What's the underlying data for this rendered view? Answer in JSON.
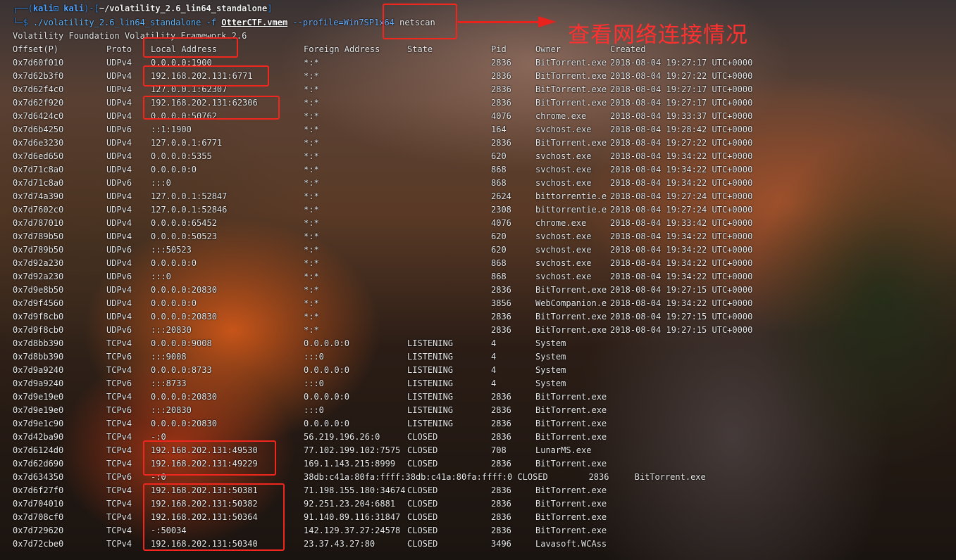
{
  "prompt": {
    "user": "kali⊡ kali",
    "path": "~/volatility_2.6_lin64_standalone",
    "command": "./volatility_2.6_lin64_standalone",
    "file": "OtterCTF.vmem",
    "option": "--profile=Win7SP1x64",
    "plugin": "netscan"
  },
  "banner": "Volatility Foundation Volatility Framework 2.6",
  "columns": [
    "Offset(P)",
    "Proto",
    "Local Address",
    "Foreign Address",
    "State",
    "Pid",
    "Owner",
    "Created"
  ],
  "rows": [
    [
      "0x7d60f010",
      "UDPv4",
      "0.0.0.0:1900",
      "*:*",
      "",
      "2836",
      "BitTorrent.exe",
      "2018-08-04 19:27:17 UTC+0000"
    ],
    [
      "0x7d62b3f0",
      "UDPv4",
      "192.168.202.131:6771",
      "*:*",
      "",
      "2836",
      "BitTorrent.exe",
      "2018-08-04 19:27:22 UTC+0000"
    ],
    [
      "0x7d62f4c0",
      "UDPv4",
      "127.0.0.1:62307",
      "*:*",
      "",
      "2836",
      "BitTorrent.exe",
      "2018-08-04 19:27:17 UTC+0000"
    ],
    [
      "0x7d62f920",
      "UDPv4",
      "192.168.202.131:62306",
      "*:*",
      "",
      "2836",
      "BitTorrent.exe",
      "2018-08-04 19:27:17 UTC+0000"
    ],
    [
      "0x7d6424c0",
      "UDPv4",
      "0.0.0.0:50762",
      "*:*",
      "",
      "4076",
      "chrome.exe",
      "2018-08-04 19:33:37 UTC+0000"
    ],
    [
      "0x7d6b4250",
      "UDPv6",
      "::1:1900",
      "*:*",
      "",
      "164",
      "svchost.exe",
      "2018-08-04 19:28:42 UTC+0000"
    ],
    [
      "0x7d6e3230",
      "UDPv4",
      "127.0.0.1:6771",
      "*:*",
      "",
      "2836",
      "BitTorrent.exe",
      "2018-08-04 19:27:22 UTC+0000"
    ],
    [
      "0x7d6ed650",
      "UDPv4",
      "0.0.0.0:5355",
      "*:*",
      "",
      "620",
      "svchost.exe",
      "2018-08-04 19:34:22 UTC+0000"
    ],
    [
      "0x7d71c8a0",
      "UDPv4",
      "0.0.0.0:0",
      "*:*",
      "",
      "868",
      "svchost.exe",
      "2018-08-04 19:34:22 UTC+0000"
    ],
    [
      "0x7d71c8a0",
      "UDPv6",
      ":::0",
      "*:*",
      "",
      "868",
      "svchost.exe",
      "2018-08-04 19:34:22 UTC+0000"
    ],
    [
      "0x7d74a390",
      "UDPv4",
      "127.0.0.1:52847",
      "*:*",
      "",
      "2624",
      "bittorrentie.e",
      "2018-08-04 19:27:24 UTC+0000"
    ],
    [
      "0x7d7602c0",
      "UDPv4",
      "127.0.0.1:52846",
      "*:*",
      "",
      "2308",
      "bittorrentie.e",
      "2018-08-04 19:27:24 UTC+0000"
    ],
    [
      "0x7d787010",
      "UDPv4",
      "0.0.0.0:65452",
      "*:*",
      "",
      "4076",
      "chrome.exe",
      "2018-08-04 19:33:42 UTC+0000"
    ],
    [
      "0x7d789b50",
      "UDPv4",
      "0.0.0.0:50523",
      "*:*",
      "",
      "620",
      "svchost.exe",
      "2018-08-04 19:34:22 UTC+0000"
    ],
    [
      "0x7d789b50",
      "UDPv6",
      ":::50523",
      "*:*",
      "",
      "620",
      "svchost.exe",
      "2018-08-04 19:34:22 UTC+0000"
    ],
    [
      "0x7d92a230",
      "UDPv4",
      "0.0.0.0:0",
      "*:*",
      "",
      "868",
      "svchost.exe",
      "2018-08-04 19:34:22 UTC+0000"
    ],
    [
      "0x7d92a230",
      "UDPv6",
      ":::0",
      "*:*",
      "",
      "868",
      "svchost.exe",
      "2018-08-04 19:34:22 UTC+0000"
    ],
    [
      "0x7d9e8b50",
      "UDPv4",
      "0.0.0.0:20830",
      "*:*",
      "",
      "2836",
      "BitTorrent.exe",
      "2018-08-04 19:27:15 UTC+0000"
    ],
    [
      "0x7d9f4560",
      "UDPv4",
      "0.0.0.0:0",
      "*:*",
      "",
      "3856",
      "WebCompanion.e",
      "2018-08-04 19:34:22 UTC+0000"
    ],
    [
      "0x7d9f8cb0",
      "UDPv4",
      "0.0.0.0:20830",
      "*:*",
      "",
      "2836",
      "BitTorrent.exe",
      "2018-08-04 19:27:15 UTC+0000"
    ],
    [
      "0x7d9f8cb0",
      "UDPv6",
      ":::20830",
      "*:*",
      "",
      "2836",
      "BitTorrent.exe",
      "2018-08-04 19:27:15 UTC+0000"
    ],
    [
      "0x7d8bb390",
      "TCPv4",
      "0.0.0.0:9008",
      "0.0.0.0:0",
      "LISTENING",
      "4",
      "System",
      ""
    ],
    [
      "0x7d8bb390",
      "TCPv6",
      ":::9008",
      ":::0",
      "LISTENING",
      "4",
      "System",
      ""
    ],
    [
      "0x7d9a9240",
      "TCPv4",
      "0.0.0.0:8733",
      "0.0.0.0:0",
      "LISTENING",
      "4",
      "System",
      ""
    ],
    [
      "0x7d9a9240",
      "TCPv6",
      ":::8733",
      ":::0",
      "LISTENING",
      "4",
      "System",
      ""
    ],
    [
      "0x7d9e19e0",
      "TCPv4",
      "0.0.0.0:20830",
      "0.0.0.0:0",
      "LISTENING",
      "2836",
      "BitTorrent.exe",
      ""
    ],
    [
      "0x7d9e19e0",
      "TCPv6",
      ":::20830",
      ":::0",
      "LISTENING",
      "2836",
      "BitTorrent.exe",
      ""
    ],
    [
      "0x7d9e1c90",
      "TCPv4",
      "0.0.0.0:20830",
      "0.0.0.0:0",
      "LISTENING",
      "2836",
      "BitTorrent.exe",
      ""
    ],
    [
      "0x7d42ba90",
      "TCPv4",
      "-:0",
      "56.219.196.26:0",
      "CLOSED",
      "2836",
      "BitTorrent.exe",
      ""
    ],
    [
      "0x7d6124d0",
      "TCPv4",
      "192.168.202.131:49530",
      "77.102.199.102:7575",
      "CLOSED",
      "708",
      "LunarMS.exe",
      ""
    ],
    [
      "0x7d62d690",
      "TCPv4",
      "192.168.202.131:49229",
      "169.1.143.215:8999",
      "CLOSED",
      "2836",
      "BitTorrent.exe",
      ""
    ],
    [
      "0x7d634350",
      "TCPv6",
      "-:0",
      "38db:c41a:80fa:ffff:38db:c41a:80fa:ffff:0 CLOSED        2836     BitTorrent.exe",
      "",
      "",
      "",
      ""
    ],
    [
      "0x7d6f27f0",
      "TCPv4",
      "192.168.202.131:50381",
      "71.198.155.180:34674",
      "CLOSED",
      "2836",
      "BitTorrent.exe",
      ""
    ],
    [
      "0x7d704010",
      "TCPv4",
      "192.168.202.131:50382",
      "92.251.23.204:6881",
      "CLOSED",
      "2836",
      "BitTorrent.exe",
      ""
    ],
    [
      "0x7d708cf0",
      "TCPv4",
      "192.168.202.131:50364",
      "91.140.89.116:31847",
      "CLOSED",
      "2836",
      "BitTorrent.exe",
      ""
    ],
    [
      "0x7d729620",
      "TCPv4",
      "-:50034",
      "142.129.37.27:24578",
      "CLOSED",
      "2836",
      "BitTorrent.exe",
      ""
    ],
    [
      "0x7d72cbe0",
      "TCPv4",
      "192.168.202.131:50340",
      "23.37.43.27:80",
      "CLOSED",
      "3496",
      "Lavasoft.WCAss",
      ""
    ]
  ],
  "annotation": "查看网络连接情况",
  "colors": {
    "highlight": "#f0271f",
    "prompt": "#3c8ce0",
    "text": "#e9e9e9"
  }
}
